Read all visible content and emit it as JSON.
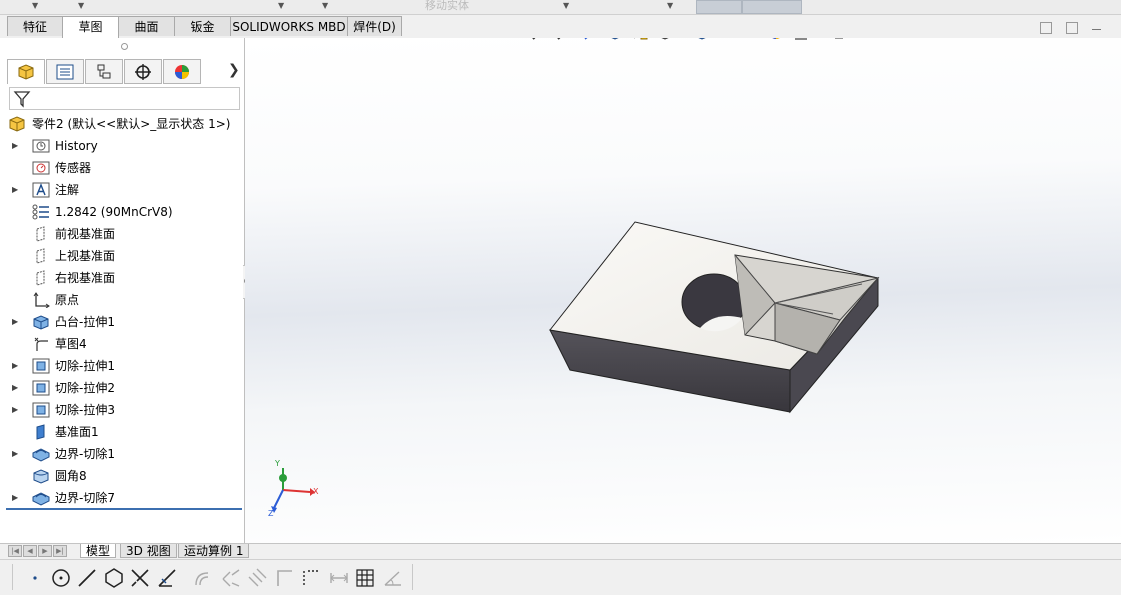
{
  "command_tabs": [
    {
      "label": "特征",
      "active": false
    },
    {
      "label": "草图",
      "active": true
    },
    {
      "label": "曲面",
      "active": false
    },
    {
      "label": "钣金",
      "active": false
    },
    {
      "label": "SOLIDWORKS MBD",
      "active": false
    },
    {
      "label": "焊件(D)",
      "active": false
    }
  ],
  "top_partial_label": "移动实体",
  "feature_tree": {
    "root_label": "零件2 (默认<<默认>_显示状态 1>)",
    "items": [
      {
        "label": "History",
        "icon": "history-icon",
        "expandable": true
      },
      {
        "label": "传感器",
        "icon": "sensor-icon",
        "expandable": false
      },
      {
        "label": "注解",
        "icon": "annotation-icon",
        "expandable": true
      },
      {
        "label": "1.2842 (90MnCrV8)",
        "icon": "material-icon",
        "expandable": false
      },
      {
        "label": "前视基准面",
        "icon": "plane-icon",
        "expandable": false
      },
      {
        "label": "上视基准面",
        "icon": "plane-icon",
        "expandable": false
      },
      {
        "label": "右视基准面",
        "icon": "plane-icon",
        "expandable": false
      },
      {
        "label": "原点",
        "icon": "origin-icon",
        "expandable": false
      },
      {
        "label": "凸台-拉伸1",
        "icon": "boss-extrude-icon",
        "expandable": true
      },
      {
        "label": "草图4",
        "icon": "sketch-icon",
        "expandable": false
      },
      {
        "label": "切除-拉伸1",
        "icon": "cut-extrude-icon",
        "expandable": true
      },
      {
        "label": "切除-拉伸2",
        "icon": "cut-extrude-icon",
        "expandable": true
      },
      {
        "label": "切除-拉伸3",
        "icon": "cut-extrude-icon",
        "expandable": true
      },
      {
        "label": "基准面1",
        "icon": "reference-plane-icon",
        "expandable": false
      },
      {
        "label": "边界-切除1",
        "icon": "boundary-cut-icon",
        "expandable": true
      },
      {
        "label": "圆角8",
        "icon": "fillet-icon",
        "expandable": false
      },
      {
        "label": "边界-切除7",
        "icon": "boundary-cut-icon",
        "expandable": true
      }
    ]
  },
  "bottom_tabs": [
    {
      "label": "模型",
      "active": true
    },
    {
      "label": "3D 视图",
      "active": false
    },
    {
      "label": "运动算例 1",
      "active": false
    }
  ],
  "triad": {
    "x_label": "X",
    "y_label": "Y",
    "z_label": "Z"
  },
  "colors": {
    "accent": "#3c6fb0",
    "model_face": "#f2f1ee",
    "model_side": "#4a4850"
  }
}
